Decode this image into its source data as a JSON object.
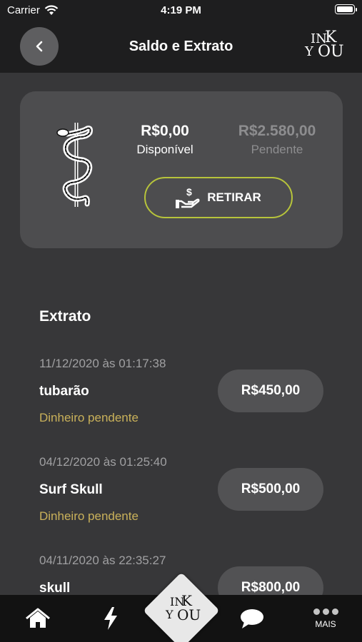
{
  "status_bar": {
    "carrier": "Carrier",
    "time": "4:19 PM"
  },
  "header": {
    "title": "Saldo e Extrato",
    "logo_text": [
      "IN",
      "K",
      "Y",
      "OU"
    ]
  },
  "balance": {
    "available_amount": "R$0,00",
    "available_label": "Disponível",
    "pending_amount": "R$2.580,00",
    "pending_label": "Pendente",
    "withdraw_label": "RETIRAR"
  },
  "statement": {
    "title": "Extrato",
    "entries": [
      {
        "date": "11/12/2020 às 01:17:38",
        "name": "tubarão",
        "status": "Dinheiro pendente",
        "amount": "R$450,00"
      },
      {
        "date": "04/12/2020 às 01:25:40",
        "name": "Surf Skull",
        "status": "Dinheiro pendente",
        "amount": "R$500,00"
      },
      {
        "date": "04/11/2020 às 22:35:27",
        "name": "skull",
        "status": "",
        "amount": "R$800,00"
      }
    ]
  },
  "tabbar": {
    "more_label": "MAIS"
  },
  "colors": {
    "accent_border": "#b7c43b",
    "pending_status": "#c9b15a",
    "background": "#373739",
    "card": "#4d4d4f"
  },
  "icons": [
    "wifi-icon",
    "battery-icon",
    "back-chevron-icon",
    "caduceus-icon",
    "money-hand-icon",
    "home-icon",
    "lightning-icon",
    "chat-bubble-icon",
    "more-dots-icon"
  ]
}
